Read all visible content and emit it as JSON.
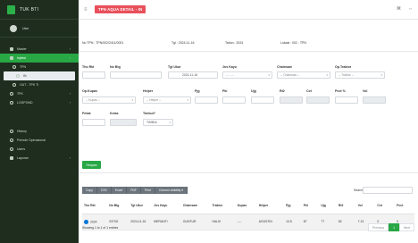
{
  "app": {
    "brand": "TUK BTI",
    "user": "User"
  },
  "sidebar": {
    "items": [
      {
        "label": "Master",
        "chev": "‹"
      },
      {
        "label": "Injeksi",
        "chev": "‹"
      },
      {
        "label": "TPN"
      },
      {
        "label": "IN"
      },
      {
        "label": "OUT - TPK TI"
      },
      {
        "label": "TPK",
        "chev": "‹"
      },
      {
        "label": "LOGPOND",
        "chev": "‹"
      },
      {
        "label": "History"
      },
      {
        "label": "Periode Operasional"
      },
      {
        "label": "Users"
      },
      {
        "label": "Laporan",
        "chev": "‹"
      }
    ]
  },
  "topbar": {
    "page_title": "TPN AQUA DETAIL - IN",
    "icon_a": "⌘",
    "icon_b": "⇔"
  },
  "info": {
    "no_tpn": "No TPN : TPN/002/2411/0001",
    "tgl": "Tgl : 2024-11-16",
    "tahun": "Tahun : 2024",
    "lokasi": "Lokasi : 002 - TPN"
  },
  "form": {
    "labels": {
      "tho_rkt": "Tho Rkt",
      "no_btg": "No Btg",
      "tgl_ukur": "Tgl Ukur",
      "jns_kayu": "Jns Kayu",
      "chainsaw": "Chainsaw",
      "op_traktor": "Op.Traktor",
      "op_kupas": "Op.Kupas",
      "helper": "Helper",
      "pjg": "Pjg",
      "pkl": "Pkl",
      "ujg": "Ujg",
      "rt2": "Rt2",
      "cct": "Cct",
      "pcct": "Pcct %",
      "vol": "Vol",
      "petak": "Petak",
      "kelas": "Kelas",
      "timbul": "Timbul?"
    },
    "values": {
      "tgl_ukur": "2024-11-16",
      "jns_kayu": "-- -- --",
      "chainsaw": "-- Chainsaw --",
      "op_traktor": "-- Traktor --",
      "op_kupas": "-- Kupas --",
      "helper": "-- Helper --",
      "timbul": "TIMBUL"
    },
    "save_label": "Simpan"
  },
  "datatable": {
    "buttons": [
      "Copy",
      "CSV",
      "Excel",
      "PDF",
      "Print",
      "Column visibility ▾"
    ],
    "search_label": "Search:",
    "columns": [
      "Tho Rkt",
      "No Btg",
      "Tgl Ukur",
      "Jns Kayu",
      "Chainsaw",
      "Traktor",
      "Kupas",
      "Helper",
      "Pjg",
      "Pkl",
      "Ujg",
      "Rt2",
      "Vol",
      "Cct",
      "Pcct"
    ],
    "rows": [
      [
        "2024",
        "0370G",
        "2024-11-16",
        "MERANTI",
        "GUNTUR",
        "HALIK",
        "----",
        "AGUSTIN",
        "13.5",
        "87",
        "77",
        "82",
        "7.13",
        "0",
        "0"
      ]
    ],
    "showing": "Showing 1 to 1 of 1 entries",
    "pager": {
      "prev": "Previous",
      "page": "1",
      "next": "Next"
    }
  }
}
